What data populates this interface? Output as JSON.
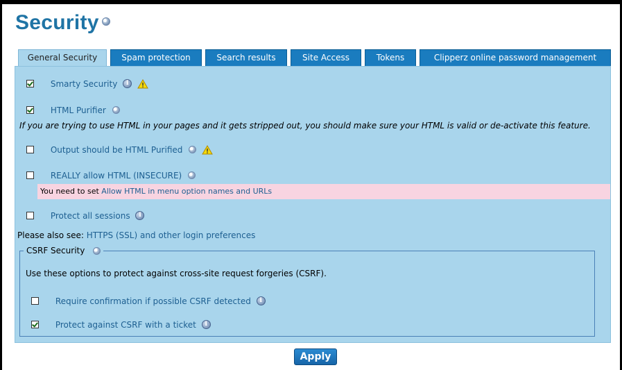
{
  "page": {
    "title": "Security"
  },
  "tabs": [
    {
      "label": "General Security",
      "active": true
    },
    {
      "label": "Spam protection",
      "active": false
    },
    {
      "label": "Search results",
      "active": false
    },
    {
      "label": "Site Access",
      "active": false
    },
    {
      "label": "Tokens",
      "active": false
    },
    {
      "label": "Clipperz online password management",
      "active": false
    }
  ],
  "options": {
    "smarty_security": {
      "label": "Smarty Security",
      "checked": true
    },
    "html_purifier": {
      "label": "HTML Purifier",
      "checked": true,
      "note": "If you are trying to use HTML in your pages and it gets stripped out, you should make sure your HTML is valid or de-activate this feature."
    },
    "output_purified": {
      "label": "Output should be HTML Purified",
      "checked": false
    },
    "really_allow_html": {
      "label": "REALLY allow HTML (INSECURE)",
      "checked": false,
      "note_prefix": "You need to set ",
      "note_link": "Allow HTML in menu option names and URLs"
    },
    "protect_sessions": {
      "label": "Protect all sessions",
      "checked": false
    }
  },
  "also_see": {
    "prefix": "Please also see: ",
    "link": "HTTPS (SSL) and other login preferences"
  },
  "csrf": {
    "legend": "CSRF Security",
    "description": "Use these options to protect against cross-site request forgeries (CSRF).",
    "require_confirmation": {
      "label": "Require confirmation if possible CSRF detected",
      "checked": false
    },
    "protect_ticket": {
      "label": "Protect against CSRF with a ticket",
      "checked": true
    }
  },
  "apply_label": "Apply",
  "colors": {
    "accent": "#1a7cbf",
    "panel": "#a9d5ec",
    "title": "#1f74a5",
    "note_bg": "#f8d4e1"
  }
}
